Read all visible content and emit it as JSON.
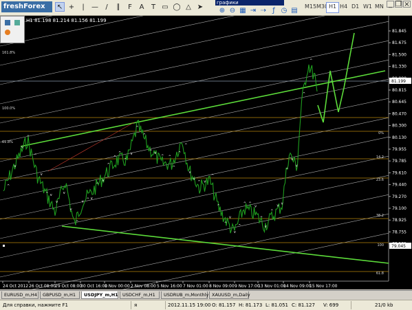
{
  "toolbar": {
    "logo": "freshForex",
    "drawing_tools": [
      "cursor-icon",
      "crosshair-icon",
      "vertical-line-icon",
      "horizontal-line-icon",
      "trendline-icon",
      "channel-icon",
      "fibo-icon",
      "text-icon",
      "label-icon",
      "rectangle-icon",
      "ellipse-icon",
      "triangle-icon",
      "arrow-icon"
    ],
    "sub_window_title": "графики",
    "chart_tools": [
      "zoom-in-icon",
      "zoom-out-icon",
      "grid-icon",
      "chart-shift-icon",
      "autoscroll-icon",
      "indicator-icon",
      "period-icon",
      "template-icon"
    ],
    "timeframes": [
      "M15",
      "M30",
      "H1",
      "H4",
      "D1",
      "W1",
      "MN"
    ],
    "active_timeframe": "H1",
    "window_controls": [
      "minimize-icon",
      "restore-icon",
      "close-icon"
    ]
  },
  "chart": {
    "ohlc_line": "H1  81.198 81.214 81.156 81.199",
    "current_price": "81.199",
    "low_marker": "79.045",
    "price_ticks": [
      "81.845",
      "81.675",
      "81.500",
      "81.330",
      "80.990",
      "80.815",
      "80.645",
      "80.470",
      "80.300",
      "80.130",
      "79.955",
      "79.785",
      "79.610",
      "79.440",
      "79.270",
      "79.100",
      "78.925",
      "78.755",
      "78.585"
    ],
    "time_ticks": [
      "24 Oct 2012",
      "26 Oct 08:00",
      "29 Oct 08:00",
      "30 Oct 16:00",
      "1 Nov 00:00",
      "2 Nov 08:00",
      "5 Nov 16:00",
      "7 Nov 01:00",
      "8 Nov 09:00",
      "9 Nov 17:00",
      "13 Nov 01:00",
      "14 Nov 09:00",
      "15 Nov 17:00"
    ],
    "fibo_labels_left": [
      "161.8%",
      "100.0%",
      "61.8%"
    ],
    "fibo_labels_right": [
      "0%",
      "14.2",
      "23.6",
      "38.2",
      "100",
      "61.8"
    ],
    "colors": {
      "background": "#000000",
      "price_line": "#1f9e1f",
      "trend_line": "#5cdc3a",
      "channel_lines": "#d8d8d8",
      "fibo_levels": "#b8860b",
      "current_price_line": "#8899aa"
    }
  },
  "tabs": {
    "items": [
      "EURUSD_m,H4",
      "GBPUSD_m,H1",
      "USDJPY_m,H1",
      "USDCHF_m,H1",
      "USDRUB_m,Monthly",
      "XAUUSD_m,Daily"
    ],
    "active": "USDJPY_m,H1"
  },
  "status": {
    "help": "Для справки, нажмите F1",
    "profile": "я",
    "datetime": "2012.11.15 19:00",
    "open": "O: 81.157",
    "high": "H: 81.173",
    "low": "L: 81.051",
    "close": "C: 81.127",
    "volume": "V: 699",
    "traffic": "21/0 kb"
  }
}
